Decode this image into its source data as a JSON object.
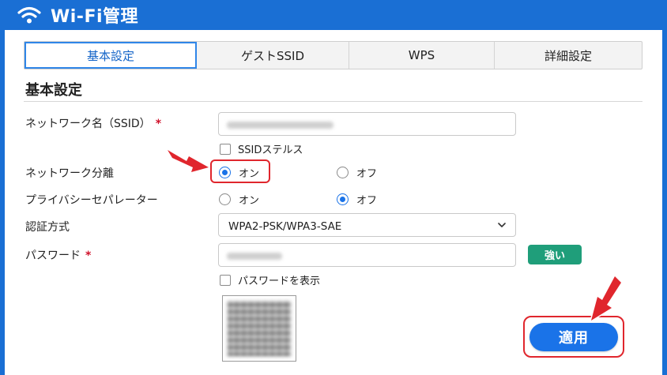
{
  "app": {
    "title": "Wi-Fi管理",
    "header_icon": "wifi-icon"
  },
  "tabs": [
    {
      "label": "基本設定",
      "active": true
    },
    {
      "label": "ゲストSSID",
      "active": false
    },
    {
      "label": "WPS",
      "active": false
    },
    {
      "label": "詳細設定",
      "active": false
    }
  ],
  "section": {
    "title": "基本設定"
  },
  "form": {
    "ssid": {
      "label": "ネットワーク名（SSID）",
      "required_mark": "*"
    },
    "stealth": {
      "label": "SSIDステルス",
      "checked": false
    },
    "isolation": {
      "label": "ネットワーク分離",
      "on": "オン",
      "off": "オフ",
      "selected": "オン"
    },
    "privacy": {
      "label": "プライバシーセパレーター",
      "on": "オン",
      "off": "オフ",
      "selected": "オフ"
    },
    "auth": {
      "label": "認証方式",
      "value": "WPA2-PSK/WPA3-SAE"
    },
    "password": {
      "label": "パスワード",
      "required_mark": "*",
      "strength": "強い"
    },
    "show_password": {
      "label": "パスワードを表示",
      "checked": false
    }
  },
  "apply_button": {
    "label": "適用"
  },
  "colors": {
    "header_bg": "#1a6fd4",
    "accent": "#1a73e8",
    "highlight": "#e0262d",
    "strength_badge": "#1f9e7a"
  }
}
